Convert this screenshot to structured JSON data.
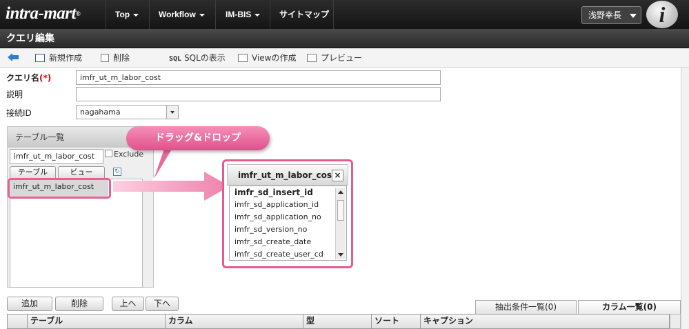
{
  "header": {
    "logo": "intra-mart",
    "nav": [
      "Top",
      "Workflow",
      "IM-BIS",
      "サイトマップ"
    ],
    "user": "浅野幸長",
    "user_icon": "i"
  },
  "page_title": "クエリ編集",
  "toolbar": {
    "new": "新規作成",
    "delete": "削除",
    "sql_show": "SQLの表示",
    "view_create": "Viewの作成",
    "preview": "プレビュー"
  },
  "form": {
    "query_name_label": "クエリ名",
    "required_mark": "(*)",
    "query_name_value": "imfr_ut_m_labor_cost",
    "description_label": "説明",
    "description_value": "",
    "connection_label": "接続ID",
    "connection_value": "nagahama"
  },
  "table_panel": {
    "title": "テーブル一覧",
    "filter_value": "imfr_ut_m_labor_cost",
    "exclude_label": "Exclude",
    "tab_table": "テーブル",
    "tab_view": "ビュー",
    "items": [
      "imfr_ut_m_labor_cost"
    ]
  },
  "callout": "ドラッグ&ドロップ",
  "popup": {
    "title": "imfr_ut_m_labor_cost",
    "close": "×",
    "columns": [
      "imfr_sd_insert_id",
      "imfr_sd_application_id",
      "imfr_sd_application_no",
      "imfr_sd_version_no",
      "imfr_sd_create_date",
      "imfr_sd_create_user_cd"
    ]
  },
  "bottom": {
    "add": "追加",
    "remove": "削除",
    "up": "上へ",
    "down": "下へ",
    "tab_conditions": "抽出条件一覧(0)",
    "tab_columns": "カラム一覧(0)",
    "grid_headers": [
      "テーブル",
      "カラム",
      "型",
      "ソート",
      "キャプション"
    ]
  },
  "colors": {
    "highlight": "#e85f94",
    "topbar": "#1e1e1e"
  }
}
